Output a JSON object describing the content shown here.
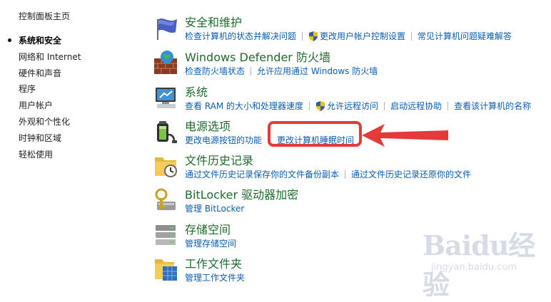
{
  "sidebar": {
    "home": "控制面板主页",
    "items": [
      {
        "label": "系统和安全",
        "active": true
      },
      {
        "label": "网络和 Internet"
      },
      {
        "label": "硬件和声音"
      },
      {
        "label": "程序"
      },
      {
        "label": "用户帐户"
      },
      {
        "label": "外观和个性化"
      },
      {
        "label": "时钟和区域"
      },
      {
        "label": "轻松使用"
      }
    ]
  },
  "categories": [
    {
      "icon": "security-flag-icon",
      "title": "安全和维护",
      "links": [
        "检查计算机的状态并解决问题",
        "更改用户帐户控制设置",
        "常见计算机问题疑难解答"
      ]
    },
    {
      "icon": "firewall-icon",
      "title": "Windows Defender 防火墙",
      "links": [
        "检查防火墙状态",
        "允许应用通过 Windows 防火墙"
      ]
    },
    {
      "icon": "system-computer-icon",
      "title": "系统",
      "links": [
        "查看 RAM 的大小和处理器速度",
        "允许远程访问",
        "启动远程协助",
        "查看该计算机的名称"
      ]
    },
    {
      "icon": "power-options-icon",
      "title": "电源选项",
      "links": [
        "更改电源按钮的功能",
        "更改计算机睡眠时间"
      ]
    },
    {
      "icon": "file-history-icon",
      "title": "文件历史记录",
      "links": [
        "通过文件历史记录保存你的文件备份副本",
        "通过文件历史记录还原你的文件"
      ]
    },
    {
      "icon": "bitlocker-icon",
      "title": "BitLocker 驱动器加密",
      "links": [
        "管理 BitLocker"
      ]
    },
    {
      "icon": "storage-spaces-icon",
      "title": "存储空间",
      "links": [
        "管理存储空间"
      ]
    },
    {
      "icon": "work-folders-icon",
      "title": "工作文件夹",
      "links": [
        "管理工作文件夹"
      ]
    }
  ],
  "watermark": {
    "brand": "Baidu经验",
    "url": "jingyan.baidu.com"
  },
  "colors": {
    "title_green": "#1e6b2c",
    "link_blue": "#0a5db1",
    "annotation_red": "#e43a3a"
  }
}
